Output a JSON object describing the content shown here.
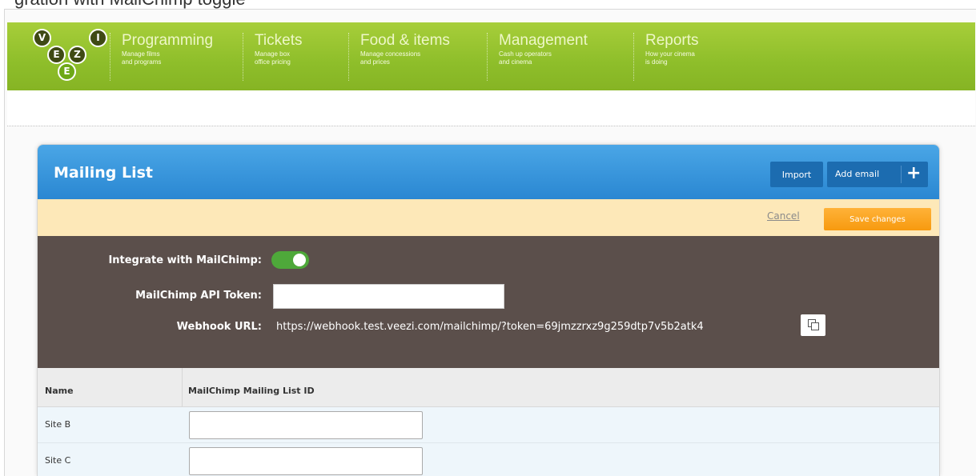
{
  "top_partial_text": "gration with MailChimp toggle",
  "logo": {
    "letters": [
      "V",
      "I",
      "E",
      "Z",
      "E"
    ]
  },
  "nav": {
    "items": [
      {
        "title": "Programming",
        "subtitle": "Manage films\nand programs"
      },
      {
        "title": "Tickets",
        "subtitle": "Manage box\noffice pricing"
      },
      {
        "title": "Food & items",
        "subtitle": "Manage concessions\nand prices"
      },
      {
        "title": "Management",
        "subtitle": "Cash up operators\nand cinema"
      },
      {
        "title": "Reports",
        "subtitle": "How your cinema\nis doing"
      }
    ]
  },
  "panel": {
    "title": "Mailing List",
    "import_label": "Import",
    "add_email_label": "Add email",
    "add_icon": "+"
  },
  "savebar": {
    "cancel_label": "Cancel",
    "save_label": "Save changes"
  },
  "settings": {
    "integrate_label": "Integrate with MailChimp:",
    "integrate_enabled": true,
    "api_token_label": "MailChimp API Token:",
    "api_token_value": "",
    "webhook_label": "Webhook URL:",
    "webhook_url": "https://webhook.test.veezi.com/mailchimp/?token=69jmzzrxz9g259dtp7v5b2atk4",
    "copy_icon": "copy-icon"
  },
  "table": {
    "headers": [
      "Name",
      "MailChimp Mailing List ID"
    ],
    "rows": [
      {
        "name": "Site B",
        "list_id": ""
      },
      {
        "name": "Site C",
        "list_id": ""
      }
    ]
  },
  "colors": {
    "nav_green": "#8ebe2a",
    "header_blue": "#2a87d2",
    "save_orange": "#f79a0f",
    "settings_bg": "#5b4f4b",
    "toggle_on": "#4ea83a"
  }
}
